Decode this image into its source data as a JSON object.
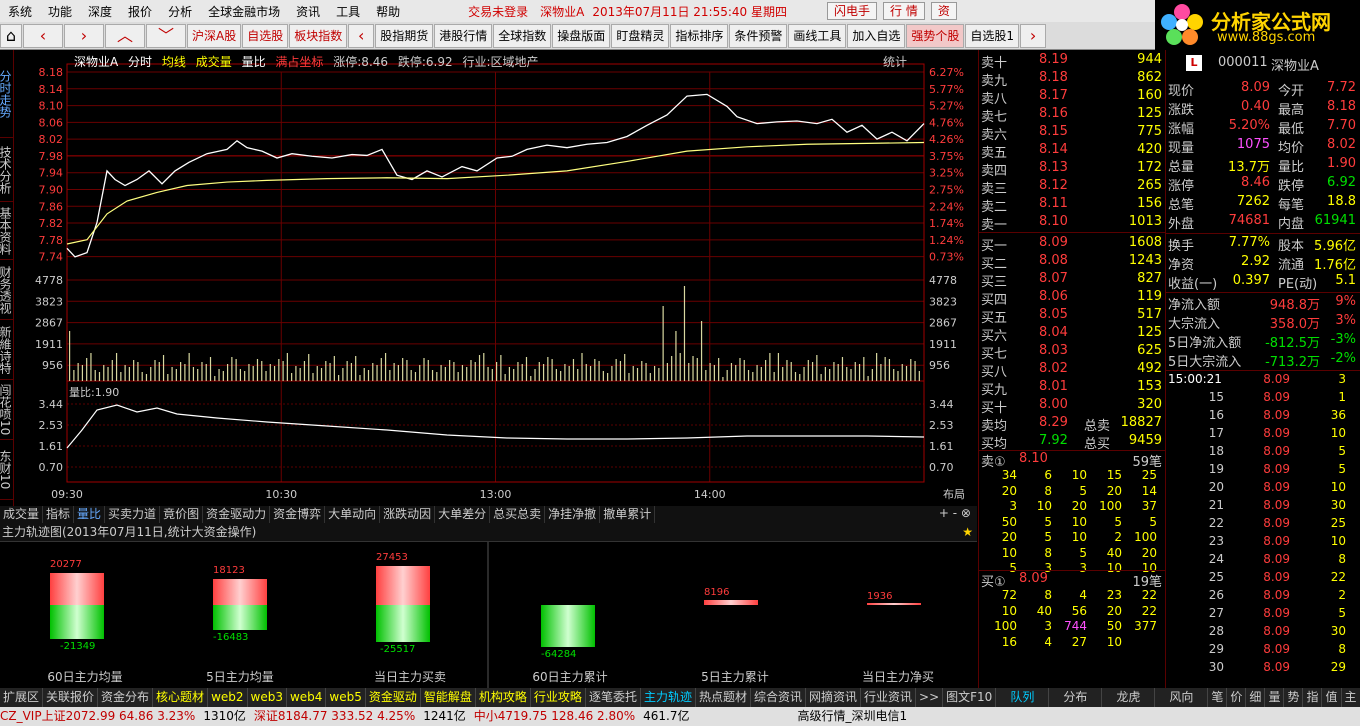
{
  "menu": [
    "系统",
    "功能",
    "深度",
    "报价",
    "分析",
    "全球金融市场",
    "资讯",
    "工具",
    "帮助"
  ],
  "status": "交易未登录",
  "stock_title": "深物业A",
  "datetime": "2013年07月11日  21:55:40  星期四",
  "top_buttons": [
    "闪电手",
    "行 情",
    "资"
  ],
  "logo": {
    "text": "分析家公式网",
    "url": "www.88gs.com"
  },
  "toolbar": [
    "沪深A股",
    "自选股",
    "板块指数",
    "股指期货",
    "港股行情",
    "全球指数",
    "操盘版面",
    "盯盘精灵",
    "指标排序",
    "条件预警",
    "画线工具",
    "加入自选",
    "强势个股",
    "自选股1"
  ],
  "left_tabs": [
    "分时走势",
    "技术分析",
    "基本资料",
    "财务透视",
    "新維诗特",
    "闯花喷10",
    "东财10"
  ],
  "chart_head": {
    "name": "深物业A",
    "items": [
      "分时",
      "均线",
      "成交量",
      "量比"
    ],
    "full": "满占坐标",
    "up_stop": "涨停:8.46",
    "down_stop": "跌停:6.92",
    "industry": "行业:区域地产",
    "stat": "统计"
  },
  "price_ticks": [
    "8.18",
    "8.14",
    "8.10",
    "8.06",
    "8.02",
    "7.98",
    "7.94",
    "7.90",
    "7.86",
    "7.82",
    "7.78",
    "7.74"
  ],
  "pct_ticks": [
    "6.27%",
    "5.77%",
    "5.27%",
    "4.76%",
    "4.26%",
    "3.75%",
    "3.25%",
    "2.75%",
    "2.24%",
    "1.74%",
    "1.24%",
    "0.73%"
  ],
  "vol_ticks": [
    "4778",
    "3823",
    "2867",
    "1911",
    "956"
  ],
  "ratio_label": "量比:1.90",
  "ratio_ticks": [
    "3.44",
    "2.53",
    "1.61",
    "0.70"
  ],
  "time_ticks": [
    "09:30",
    "10:30",
    "13:00",
    "14:00"
  ],
  "layout_btn": "布局",
  "bottom_tabs_chart": [
    "成交量",
    "指标",
    "量比",
    "买卖力道",
    "竟价图",
    "资金驱动力",
    "资金博弈",
    "大单动向",
    "涨跌动因",
    "大单差分",
    "总买总卖",
    "净挂净撤",
    "撤单累计"
  ],
  "track_title": "主力轨迹图(2013年07月11日,统计大资金操作)",
  "track": [
    {
      "label": "60日主力均量",
      "top": "20277",
      "bottom": "-21349"
    },
    {
      "label": "5日主力均量",
      "top": "18123",
      "bottom": "-16483"
    },
    {
      "label": "当日主力买卖",
      "top": "27453",
      "bottom": "-25517"
    },
    {
      "label": "60日主力累计",
      "top": "",
      "bottom": "-64284"
    },
    {
      "label": "5日主力累计",
      "top": "8196",
      "bottom": ""
    },
    {
      "label": "当日主力净买",
      "top": "1936",
      "bottom": ""
    }
  ],
  "sells": [
    [
      "卖十",
      "8.19",
      "944"
    ],
    [
      "卖九",
      "8.18",
      "862"
    ],
    [
      "卖八",
      "8.17",
      "160"
    ],
    [
      "卖七",
      "8.16",
      "125"
    ],
    [
      "卖六",
      "8.15",
      "775"
    ],
    [
      "卖五",
      "8.14",
      "420"
    ],
    [
      "卖四",
      "8.13",
      "172"
    ],
    [
      "卖三",
      "8.12",
      "265"
    ],
    [
      "卖二",
      "8.11",
      "156"
    ],
    [
      "卖一",
      "8.10",
      "1013"
    ]
  ],
  "buys": [
    [
      "买一",
      "8.09",
      "1608"
    ],
    [
      "买二",
      "8.08",
      "1243"
    ],
    [
      "买三",
      "8.07",
      "827"
    ],
    [
      "买四",
      "8.06",
      "119"
    ],
    [
      "买五",
      "8.05",
      "517"
    ],
    [
      "买六",
      "8.04",
      "125"
    ],
    [
      "买七",
      "8.03",
      "625"
    ],
    [
      "买八",
      "8.02",
      "492"
    ],
    [
      "买九",
      "8.01",
      "153"
    ],
    [
      "买十",
      "8.00",
      "320"
    ]
  ],
  "avg": [
    [
      "卖均",
      "8.29",
      "总卖",
      "18827"
    ],
    [
      "买均",
      "7.92",
      "总买",
      "9459"
    ]
  ],
  "queue_sell": {
    "label": "卖①",
    "price": "8.10",
    "count": "59笔",
    "rows": [
      [
        "34",
        "6",
        "10",
        "15",
        "25"
      ],
      [
        "20",
        "8",
        "5",
        "20",
        "14"
      ],
      [
        "3",
        "10",
        "20",
        "100",
        "37"
      ],
      [
        "50",
        "5",
        "10",
        "5",
        "5"
      ],
      [
        "20",
        "5",
        "10",
        "2",
        "100"
      ],
      [
        "10",
        "8",
        "5",
        "40",
        "20"
      ],
      [
        "5",
        "3",
        "3",
        "10",
        "10"
      ]
    ]
  },
  "queue_buy": {
    "label": "买①",
    "price": "8.09",
    "count": "19笔",
    "rows": [
      [
        "72",
        "8",
        "4",
        "23",
        "22"
      ],
      [
        "10",
        "40",
        "56",
        "20",
        "22"
      ],
      [
        "100",
        "3",
        "744",
        "50",
        "377"
      ],
      [
        "16",
        "4",
        "27",
        "10",
        ""
      ]
    ]
  },
  "code": "000011",
  "name": "深物业A",
  "quote": [
    [
      "现价",
      "8.09",
      "今开",
      "7.72"
    ],
    [
      "涨跌",
      "0.40",
      "最高",
      "8.18"
    ],
    [
      "涨幅",
      "5.20%",
      "最低",
      "7.70"
    ],
    [
      "现量",
      "1075",
      "均价",
      "8.02"
    ],
    [
      "总量",
      "13.7万",
      "量比",
      "1.90"
    ],
    [
      "涨停",
      "8.46",
      "跌停",
      "6.92"
    ],
    [
      "总笔",
      "7262",
      "每笔",
      "18.8"
    ],
    [
      "外盘",
      "74681",
      "内盘",
      "61941"
    ]
  ],
  "quote2": [
    [
      "换手",
      "7.77%",
      "股本",
      "5.96亿"
    ],
    [
      "净资",
      "2.92",
      "流通",
      "1.76亿"
    ],
    [
      "收益(一)",
      "0.397",
      "PE(动)",
      "5.1"
    ]
  ],
  "flows": [
    [
      "净流入额",
      "948.8万",
      "9%"
    ],
    [
      "大宗流入",
      "358.0万",
      "3%"
    ],
    [
      "5日净流入额",
      "-812.5万",
      "-3%"
    ],
    [
      "5日大宗流入",
      "-713.2万",
      "-2%"
    ]
  ],
  "ticks": [
    [
      "15:00:21",
      "8.09",
      "3"
    ],
    [
      "15",
      "8.09",
      "1"
    ],
    [
      "16",
      "8.09",
      "36"
    ],
    [
      "17",
      "8.09",
      "10"
    ],
    [
      "18",
      "8.09",
      "5"
    ],
    [
      "19",
      "8.09",
      "5"
    ],
    [
      "20",
      "8.09",
      "10"
    ],
    [
      "21",
      "8.09",
      "30"
    ],
    [
      "22",
      "8.09",
      "25"
    ],
    [
      "23",
      "8.09",
      "10"
    ],
    [
      "24",
      "8.09",
      "8"
    ],
    [
      "25",
      "8.09",
      "22"
    ],
    [
      "26",
      "8.09",
      "2"
    ],
    [
      "27",
      "8.09",
      "5"
    ],
    [
      "28",
      "8.09",
      "30"
    ],
    [
      "29",
      "8.09",
      "8"
    ],
    [
      "30",
      "8.09",
      "29"
    ]
  ],
  "bottom_tabs": [
    "扩展区",
    "关联报价",
    "资金分布",
    "核心题材",
    "web2",
    "web3",
    "web4",
    "web5",
    "资金驱动",
    "智能解盘",
    "机构攻略",
    "行业攻略",
    "逐笔委托",
    "主力轨迹",
    "热点题材",
    "综合资讯",
    "网摘资讯",
    "行业资讯",
    ">>",
    "图文F10",
    "队列",
    "分布",
    "龙虎",
    "风向",
    "笔",
    "价",
    "细",
    "量",
    "势",
    "指",
    "值",
    "主"
  ],
  "statusbar": [
    "CZ_VIP上证2072.99  64.86  3.23%",
    "1310亿",
    "深证8184.77  333.52  4.25%",
    "1241亿",
    "中小4719.75  128.46  2.80%",
    "461.7亿",
    "高级行情_深圳电信1"
  ]
}
